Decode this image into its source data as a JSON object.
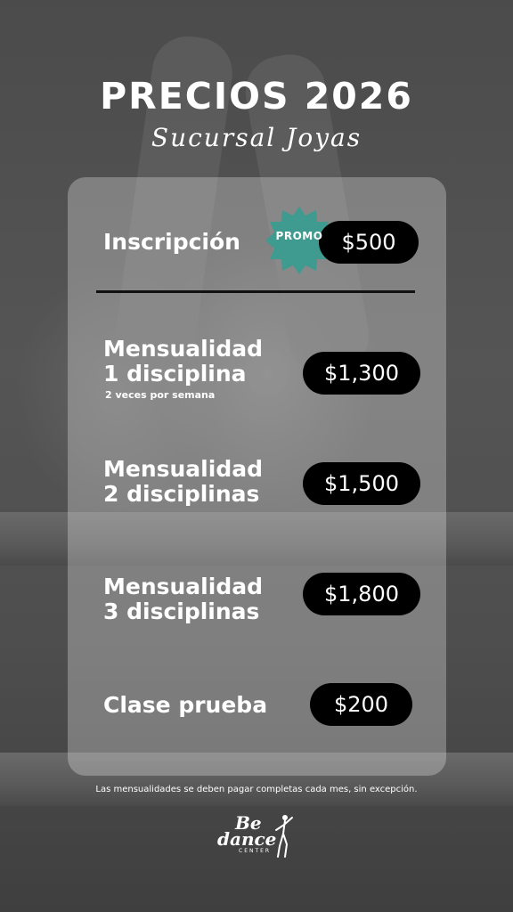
{
  "header": {
    "title": "PRECIOS 2026",
    "subtitle": "Sucursal Joyas"
  },
  "rows": [
    {
      "label": "Inscripción",
      "price": "$500",
      "promo": "PROMO"
    },
    {
      "label_line1": "Mensualidad",
      "label_line2": "1 disciplina",
      "sub": "2 veces por semana",
      "price": "$1,300"
    },
    {
      "label_line1": "Mensualidad",
      "label_line2": "2 disciplinas",
      "price": "$1,500"
    },
    {
      "label_line1": "Mensualidad",
      "label_line2": "3 disciplinas",
      "price": "$1,800"
    },
    {
      "label": "Clase prueba",
      "price": "$200"
    }
  ],
  "footer": {
    "note": "Las mensualidades se deben pagar completas cada mes, sin excepción.",
    "logo_be": "Be",
    "logo_dance": "dance",
    "logo_center": "CENTER"
  },
  "colors": {
    "promo_badge": "#3f9a8f",
    "price_pill": "#000000",
    "card_overlay": "rgba(230,230,230,0.32)"
  }
}
